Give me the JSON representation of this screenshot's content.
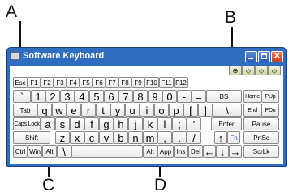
{
  "callouts": {
    "a": "A",
    "b": "B",
    "c": "C",
    "d": "D"
  },
  "window": {
    "title": "Software Keyboard",
    "buttons": {
      "minimize": "",
      "maximize": "",
      "close": "✕"
    }
  },
  "icon_buttons": [
    "⊕",
    "◇",
    "◇",
    "◇"
  ],
  "function_row": [
    "Esc",
    "F1",
    "F2",
    "F3",
    "F4",
    "F5",
    "F6",
    "F7",
    "F8",
    "F9",
    "F10",
    "F11",
    "F12"
  ],
  "number_row": [
    "`",
    "1",
    "2",
    "3",
    "4",
    "5",
    "6",
    "7",
    "8",
    "9",
    "0",
    "-",
    "=",
    "BS",
    "Home",
    "PUp"
  ],
  "q_row": [
    "Tab",
    "q",
    "w",
    "e",
    "r",
    "t",
    "y",
    "u",
    "i",
    "o",
    "p",
    "[",
    "]",
    "\\",
    "End",
    "PDn"
  ],
  "a_row": [
    "Caps Lock",
    "a",
    "s",
    "d",
    "f",
    "g",
    "h",
    "j",
    "k",
    "l",
    ";",
    "'",
    "Enter",
    "Pause"
  ],
  "z_row": [
    "Shift",
    "z",
    "x",
    "c",
    "v",
    "b",
    "n",
    "m",
    ",",
    ".",
    "/",
    "↑",
    "Fn",
    "PrtSc"
  ],
  "bottom_row": [
    "Ctrl",
    "Win",
    "Alt",
    "\\",
    "Alt",
    "App",
    "Ins",
    "Del",
    "←",
    "↓",
    "→",
    "ScrLk"
  ],
  "colors": {
    "titlebar": "#2f6dbf",
    "fn_label": "#2a55c8",
    "close_button": "#d9532b"
  }
}
